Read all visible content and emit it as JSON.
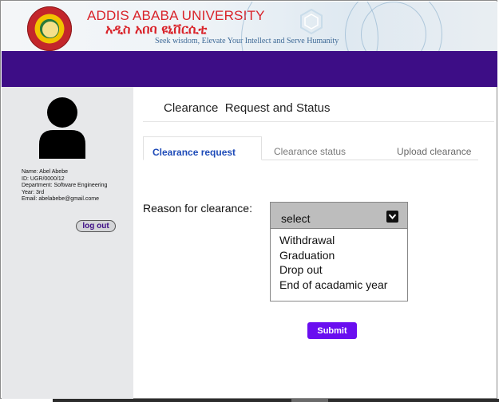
{
  "header": {
    "university_en": "ADDIS ABABA UNIVERSITY",
    "university_am": "አዲስ አበባ ዩኒቨርሲቲ",
    "motto": "Seek wisdom, Elevate Your Intellect and Serve Humanity"
  },
  "colors": {
    "nav": "#3d0d86",
    "brand_red": "#d9232a",
    "submit": "#6a0ef0",
    "active_tab": "#1e4bb8"
  },
  "sidebar": {
    "name": "Name: Abel Abebe",
    "id": "ID: UGR/0000/12",
    "department": "Department:  Software Engineering",
    "year": "Year: 3rd",
    "email": "Email: abelabebe@gmail.come",
    "logout_label": "log out"
  },
  "main": {
    "title": "Clearance  Request and Status",
    "tabs": [
      {
        "label": "Clearance request",
        "active": true
      },
      {
        "label": "Clearance status",
        "active": false
      },
      {
        "label": "Upload clearance",
        "active": false
      }
    ],
    "reason_label": "Reason for clearance:",
    "select": {
      "value": "select",
      "options": [
        "Withdrawal",
        "Graduation",
        "Drop out",
        "End of acadamic year"
      ]
    },
    "submit_label": "Submit"
  }
}
